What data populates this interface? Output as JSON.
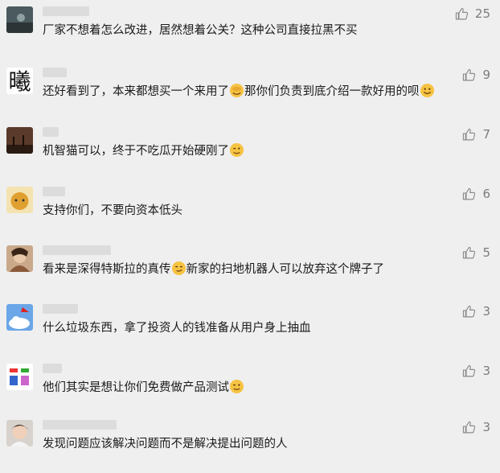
{
  "comments": [
    {
      "text": "厂家不想着怎么改进，居然想着公关？这种公司直接拉黑不买",
      "likes": "25"
    },
    {
      "text1": "还好看到了，本来都想买一个来用了",
      "text2": "那你们负责到底介绍一款好用的呗",
      "likes": "9",
      "avatar_char": "曦"
    },
    {
      "text": "机智猫可以，终于不吃瓜开始硬刚了",
      "likes": "7"
    },
    {
      "text": "支持你们，不要向资本低头",
      "likes": "6"
    },
    {
      "text1": "看来是深得特斯拉的真传",
      "text2": "新家的扫地机器人可以放弃这个牌子了",
      "likes": "5"
    },
    {
      "text": "什么垃圾东西，拿了投资人的钱准备从用户身上抽血",
      "likes": "3"
    },
    {
      "text": "他们其实是想让你们免费做产品测试",
      "likes": "3"
    },
    {
      "text": "发现问题应该解决问题而不是解决提出问题的人",
      "likes": "3"
    }
  ],
  "colors": {
    "background": "#efefef",
    "text": "#1a1a1a",
    "muted": "#7c7c7c"
  },
  "icons": [
    "thumbs-up-icon"
  ]
}
